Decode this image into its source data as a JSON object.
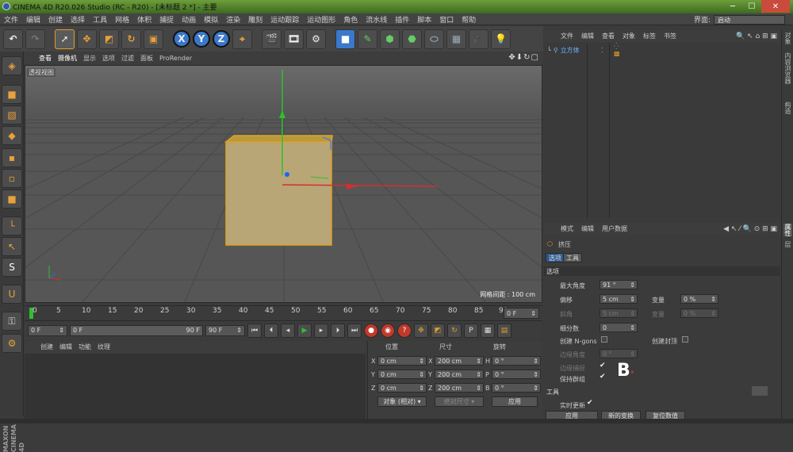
{
  "window": {
    "title": "CINEMA 4D R20.026 Studio (RC - R20) - [未标题 2 *] - 主要"
  },
  "menu": [
    "文件",
    "编辑",
    "创建",
    "选择",
    "工具",
    "网格",
    "体积",
    "捕捉",
    "动画",
    "模拟",
    "渲染",
    "雕刻",
    "运动跟踪",
    "运动图形",
    "角色",
    "流水线",
    "插件",
    "脚本",
    "窗口",
    "帮助"
  ],
  "layout": {
    "label": "界面:",
    "value": "启动"
  },
  "viewport": {
    "menu": [
      "查看",
      "摄像机",
      "显示",
      "选项",
      "过滤",
      "面板",
      "ProRender"
    ],
    "label": "透视视图",
    "grid_readout": "网格间距 : 100 cm"
  },
  "timeline": {
    "ticks": [
      "0",
      "5",
      "10",
      "15",
      "20",
      "25",
      "30",
      "35",
      "40",
      "45",
      "50",
      "55",
      "60",
      "65",
      "70",
      "75",
      "80",
      "85",
      "90"
    ],
    "current": "0 F"
  },
  "transport": {
    "start": "0 F",
    "range_start": "0 F",
    "range_end": "90 F",
    "end": "90 F"
  },
  "material": {
    "menu": [
      "创建",
      "编辑",
      "功能",
      "纹理"
    ]
  },
  "coords": {
    "headers": [
      "位置",
      "尺寸",
      "旋转"
    ],
    "rows": [
      {
        "p_axis": "X",
        "p": "0 cm",
        "s_axis": "X",
        "s": "200 cm",
        "r_axis": "H",
        "r": "0 °"
      },
      {
        "p_axis": "Y",
        "p": "0 cm",
        "s_axis": "Y",
        "s": "200 cm",
        "r_axis": "P",
        "r": "0 °"
      },
      {
        "p_axis": "Z",
        "p": "0 cm",
        "s_axis": "Z",
        "s": "200 cm",
        "r_axis": "B",
        "r": "0 °"
      }
    ],
    "mode": "对象 (相对)",
    "size_mode": "绝对尺寸",
    "apply": "应用"
  },
  "objects": {
    "menu": [
      "文件",
      "编辑",
      "查看",
      "对象",
      "标签",
      "书签"
    ],
    "item": "立方体"
  },
  "right_tabs": [
    "对象",
    "内容浏览器",
    "构造",
    "属性",
    "层"
  ],
  "attributes": {
    "menu": [
      "模式",
      "编辑",
      "用户数据"
    ],
    "object_name": "挤压",
    "tabs": [
      "选项",
      "工具"
    ],
    "section_options": "选项",
    "max_angle_label": "最大角度",
    "max_angle": "91 °",
    "offset_label": "偏移",
    "offset": "5 cm",
    "variance_label": "变量",
    "variance": "0 %",
    "bevel_label": "斜角",
    "bevel": "5 cm",
    "variance2_label": "变量",
    "variance2": "0 %",
    "subdiv_label": "细分数",
    "subdiv": "0",
    "create_ngons": "创建 N-gons",
    "create_caps": "创建封顶",
    "edge_angle_label": "边缘角度",
    "edge_angle": "0 °",
    "edge_cap": "边缘捕捉",
    "keep_groups": "保持群组",
    "section_tool": "工具",
    "realtime": "实时更新",
    "apply": "应用",
    "new_transform": "新的变换",
    "reset": "复位数值"
  },
  "brand": "MAXON CINEMA 4D"
}
